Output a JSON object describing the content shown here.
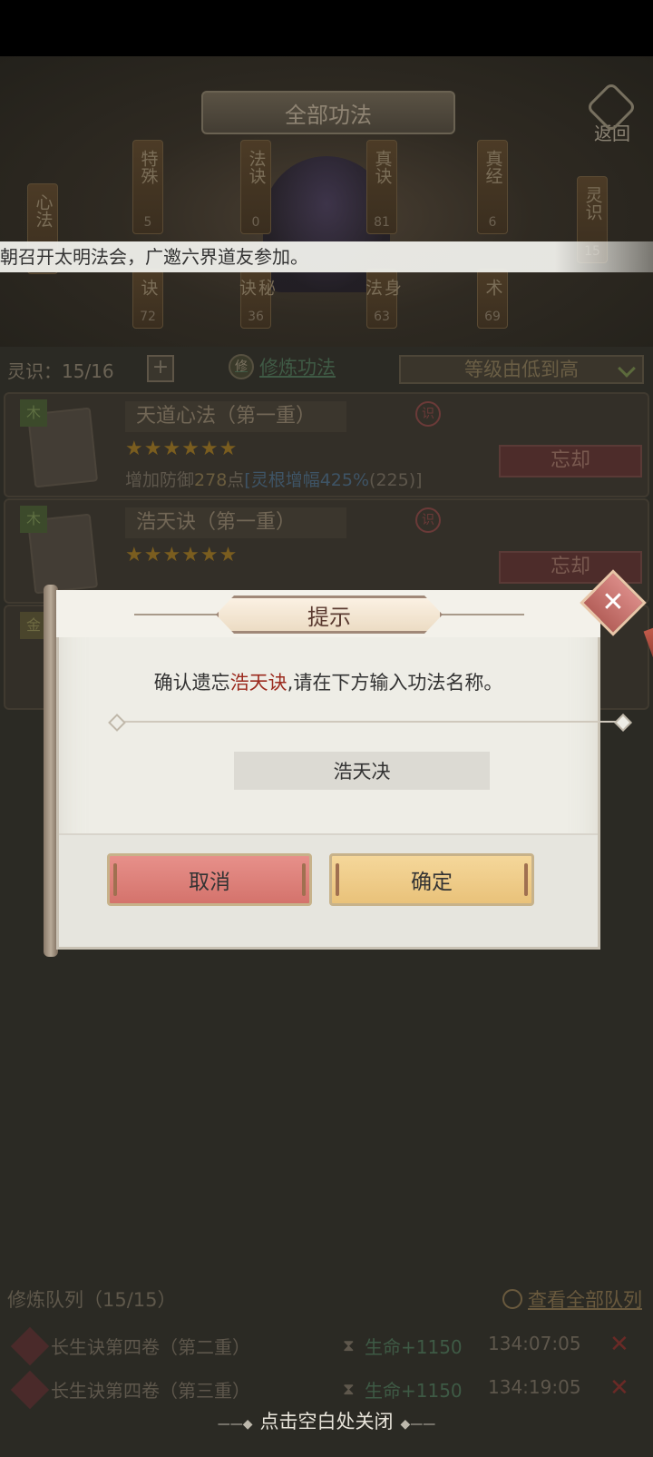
{
  "header": {
    "title": "全部功法",
    "back_label": "返回"
  },
  "categories": [
    {
      "label": "心法",
      "count": ""
    },
    {
      "label": "特殊",
      "count": "5"
    },
    {
      "label": "法诀",
      "count": "0"
    },
    {
      "label": "真诀",
      "count": "81"
    },
    {
      "label": "真经",
      "count": "6"
    },
    {
      "label": "灵识",
      "count": "15"
    }
  ],
  "categories_lower": [
    {
      "label": "诀",
      "count": "72"
    },
    {
      "label": "秘诀",
      "count": "36"
    },
    {
      "label": "身法",
      "count": "63"
    },
    {
      "label": "术",
      "count": "69"
    }
  ],
  "marquee": "朝召开太明法会，广邀六界道友参加。",
  "info": {
    "lingshi": "灵识：15/16",
    "plus": "+",
    "xiulian_icon": "修",
    "xiulian": "修炼功法",
    "sort": "等级由低到高"
  },
  "cards": [
    {
      "element": "木",
      "name": "天道心法（第一重）",
      "stars": "★★★★★★",
      "desc_prefix": "增加防御",
      "desc_num": "278",
      "desc_unit": "点",
      "desc_bonus": "[灵根增幅425%",
      "desc_tail": "(225)]",
      "shi": "识",
      "forget": "忘却"
    },
    {
      "element": "木",
      "name": "浩天诀（第一重）",
      "stars": "★★★★★★",
      "shi": "识",
      "forget": "忘却"
    },
    {
      "element": "金"
    }
  ],
  "queue": {
    "title": "修炼队列（15/15）",
    "view_all": "查看全部队列",
    "rows": [
      {
        "name": "长生诀第四卷（第二重）",
        "effect": "生命+1150",
        "time": "134:07:05"
      },
      {
        "name": "长生诀第四卷（第三重）",
        "effect": "生命+1150",
        "time": "134:19:05"
      }
    ]
  },
  "close_hint": "点击空白处关闭",
  "modal": {
    "title": "提示",
    "msg_prefix": "确认遗忘",
    "msg_highlight": "浩天诀",
    "msg_suffix": ",请在下方输入功法名称。",
    "input_value": "浩天决",
    "cancel": "取消",
    "confirm": "确定"
  }
}
